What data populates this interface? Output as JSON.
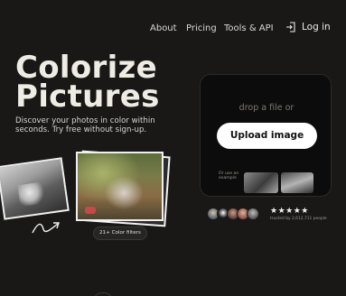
{
  "nav": {
    "links": [
      "About",
      "Pricing",
      "Tools & API"
    ],
    "login_label": "Log in"
  },
  "hero": {
    "title_line1": "Colorize",
    "title_line2": "Pictures",
    "subtitle": "Discover your photos in color within seconds. Try free without sign-up."
  },
  "showcase": {
    "filters_badge": "21+ Color filters"
  },
  "upload": {
    "drop_text": "drop a file or",
    "button_label": "Upload image",
    "example_label": "Or use an example"
  },
  "trust": {
    "stars": "★★★★★",
    "text": "trusted by 2,612,711 people"
  },
  "colors": {
    "background": "#191817",
    "card": "#0c0c0c",
    "button": "#ffffff"
  }
}
